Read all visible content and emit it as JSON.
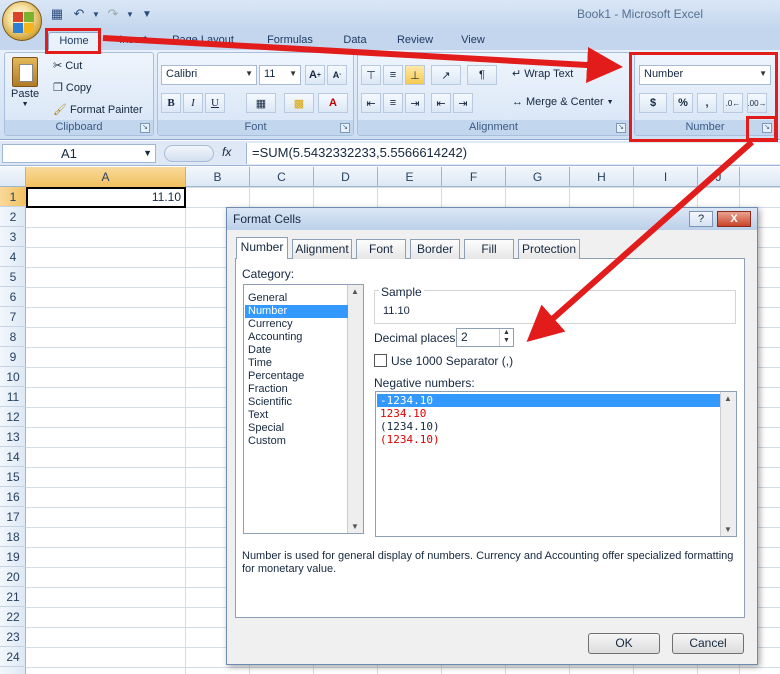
{
  "window": {
    "title": "Book1 - Microsoft Excel"
  },
  "qat": [
    "save-icon",
    "undo-icon",
    "redo-icon",
    "customize-icon"
  ],
  "tabs": [
    {
      "label": "Home"
    },
    {
      "label": "Insert"
    },
    {
      "label": "Page Layout"
    },
    {
      "label": "Formulas"
    },
    {
      "label": "Data"
    },
    {
      "label": "Review"
    },
    {
      "label": "View"
    }
  ],
  "ribbon": {
    "clipboard": {
      "label": "Clipboard",
      "paste": "Paste",
      "cut": "Cut",
      "copy": "Copy",
      "format_painter": "Format Painter"
    },
    "font": {
      "label": "Font",
      "name": "Calibri",
      "size": "11"
    },
    "alignment": {
      "label": "Alignment",
      "wrap_text": "Wrap Text",
      "merge_center": "Merge & Center"
    },
    "number": {
      "label": "Number",
      "format": "Number",
      "currency": "$",
      "percent": "%",
      "comma": ","
    }
  },
  "formula_bar": {
    "name_box": "A1",
    "fx": "fx",
    "formula": "=SUM(5.5432332233,5.5566614242)"
  },
  "sheet": {
    "columns": [
      "A",
      "B",
      "C",
      "D",
      "E",
      "F",
      "G",
      "H",
      "I",
      "J"
    ],
    "rows": [
      "1",
      "2",
      "3",
      "4",
      "5",
      "6",
      "7",
      "8",
      "9",
      "10",
      "11",
      "12",
      "13",
      "14",
      "15",
      "16",
      "17",
      "18",
      "19",
      "20",
      "21",
      "22",
      "23",
      "24"
    ],
    "a1_value": "11.10"
  },
  "dialog": {
    "title": "Format Cells",
    "help": "?",
    "close": "X",
    "tabs": [
      "Number",
      "Alignment",
      "Font",
      "Border",
      "Fill",
      "Protection"
    ],
    "category_label": "Category:",
    "categories": [
      "General",
      "Number",
      "Currency",
      "Accounting",
      "Date",
      "Time",
      "Percentage",
      "Fraction",
      "Scientific",
      "Text",
      "Special",
      "Custom"
    ],
    "selected_category": "Number",
    "sample_label": "Sample",
    "sample_value": "11.10",
    "decimal_places_label": "Decimal places:",
    "decimal_places": "2",
    "separator_label": "Use 1000 Separator (,)",
    "negative_label": "Negative numbers:",
    "negative_numbers": [
      "-1234.10",
      "1234.10",
      "(1234.10)",
      "(1234.10)"
    ],
    "description": "Number is used for general display of numbers.  Currency and Accounting offer specialized formatting for monetary value.",
    "ok": "OK",
    "cancel": "Cancel"
  },
  "colors": {
    "annotation": "#e21b1b",
    "selection": "#3399ff",
    "negative_red": "#e00000"
  }
}
